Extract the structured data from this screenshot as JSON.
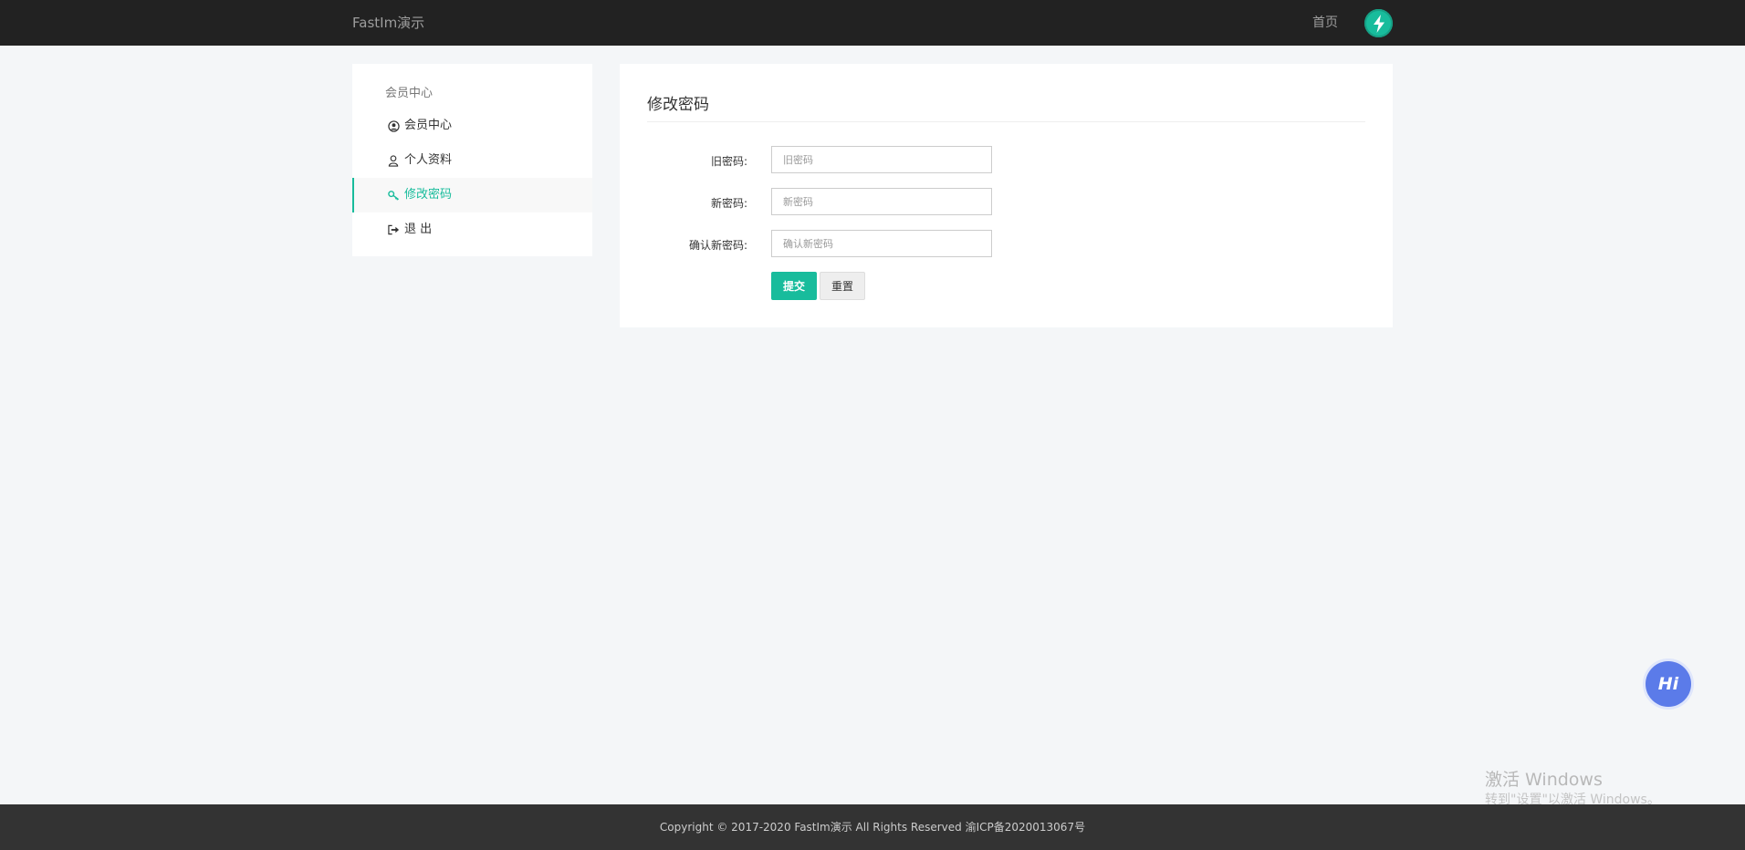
{
  "header": {
    "brand": "FastIm演示",
    "nav_home": "首页",
    "accent": "#18bc9c"
  },
  "sidebar": {
    "heading": "会员中心",
    "items": [
      {
        "label": "会员中心",
        "icon": "user-circle-icon",
        "active": false
      },
      {
        "label": "个人资料",
        "icon": "user-icon",
        "active": false
      },
      {
        "label": "修改密码",
        "icon": "key-icon",
        "active": true
      },
      {
        "label": "退 出",
        "icon": "sign-out-icon",
        "active": false
      }
    ]
  },
  "main": {
    "title": "修改密码",
    "fields": [
      {
        "label": "旧密码:",
        "placeholder": "旧密码",
        "value": ""
      },
      {
        "label": "新密码:",
        "placeholder": "新密码",
        "value": ""
      },
      {
        "label": "确认新密码:",
        "placeholder": "确认新密码",
        "value": ""
      }
    ],
    "submit_label": "提交",
    "reset_label": "重置"
  },
  "chat": {
    "label": "Hi",
    "color": "#5b7be9"
  },
  "watermark": {
    "title": "激活 Windows",
    "subtitle": "转到\"设置\"以激活 Windows。"
  },
  "footer": {
    "text": "Copyright © 2017-2020 FastIm演示 All Rights Reserved 渝ICP备2020013067号"
  }
}
